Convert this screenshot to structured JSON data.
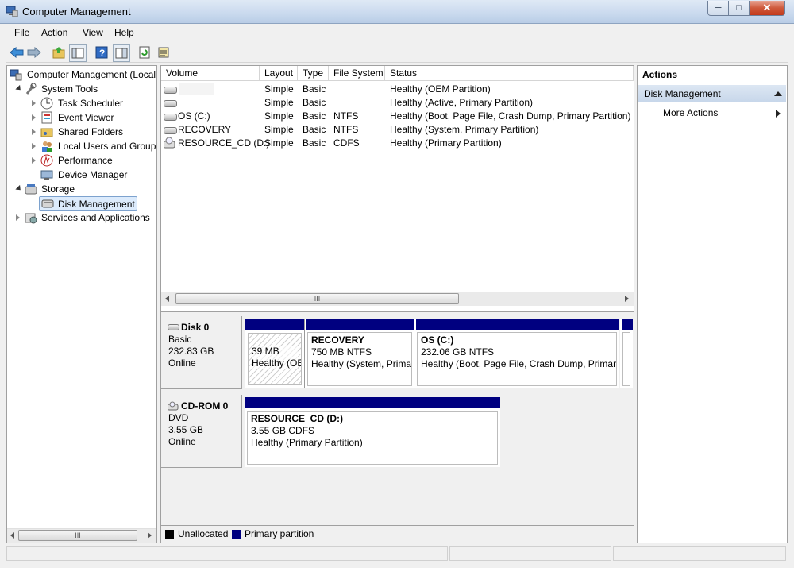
{
  "window": {
    "title": "Computer Management"
  },
  "menu": {
    "file": "File",
    "action": "Action",
    "view": "View",
    "help": "Help",
    "file_key": "F",
    "file_rest": "ile",
    "action_key": "A",
    "action_rest": "ction",
    "view_key": "V",
    "view_rest": "iew",
    "help_key": "H",
    "help_rest": "elp"
  },
  "toolbar": {
    "icons": [
      "back-arrow-icon",
      "forward-arrow-icon",
      "up-folder-icon",
      "show-hide-tree-icon",
      "help-icon",
      "show-hide-action-pane-icon",
      "refresh-icon",
      "properties-icon"
    ]
  },
  "tree": {
    "root": "Computer Management (Local",
    "system_tools": "System Tools",
    "task_scheduler": "Task Scheduler",
    "event_viewer": "Event Viewer",
    "shared_folders": "Shared Folders",
    "local_users": "Local Users and Groups",
    "performance": "Performance",
    "device_manager": "Device Manager",
    "storage": "Storage",
    "disk_management": "Disk Management",
    "services": "Services and Applications"
  },
  "volumes": {
    "headers": [
      "Volume",
      "Layout",
      "Type",
      "File System",
      "Status"
    ],
    "rows": [
      {
        "volume": "",
        "layout": "Simple",
        "type": "Basic",
        "fs": "",
        "status": "Healthy (OEM Partition)"
      },
      {
        "volume": "",
        "layout": "Simple",
        "type": "Basic",
        "fs": "",
        "status": "Healthy (Active, Primary Partition)"
      },
      {
        "volume": "OS (C:)",
        "layout": "Simple",
        "type": "Basic",
        "fs": "NTFS",
        "status": "Healthy (Boot, Page File, Crash Dump, Primary Partition)"
      },
      {
        "volume": "RECOVERY",
        "layout": "Simple",
        "type": "Basic",
        "fs": "NTFS",
        "status": "Healthy (System, Primary Partition)"
      },
      {
        "volume": "RESOURCE_CD (D:)",
        "layout": "Simple",
        "type": "Basic",
        "fs": "CDFS",
        "status": "Healthy (Primary Partition)"
      }
    ],
    "scroll_thumb": "III"
  },
  "disks": {
    "disk0": {
      "name": "Disk 0",
      "type": "Basic",
      "size": "232.83 GB",
      "state": "Online",
      "p1": {
        "size": "39 MB",
        "status": "Healthy (OEM"
      },
      "p2": {
        "name": "RECOVERY",
        "size": "750 MB NTFS",
        "status": "Healthy (System, Prima"
      },
      "p3": {
        "name": "OS  (C:)",
        "size": "232.06 GB NTFS",
        "status": "Healthy (Boot, Page File, Crash Dump, Primary"
      }
    },
    "cdrom0": {
      "name": "CD-ROM 0",
      "type": "DVD",
      "size": "3.55 GB",
      "state": "Online",
      "p1": {
        "name": "RESOURCE_CD  (D:)",
        "size": "3.55 GB CDFS",
        "status": "Healthy (Primary Partition)"
      }
    }
  },
  "legend": {
    "unallocated": "Unallocated",
    "primary": "Primary partition",
    "unallocated_color": "#000000",
    "primary_color": "#000080"
  },
  "actions": {
    "header": "Actions",
    "section": "Disk Management",
    "more": "More Actions"
  },
  "tree_scroll_thumb": "III"
}
